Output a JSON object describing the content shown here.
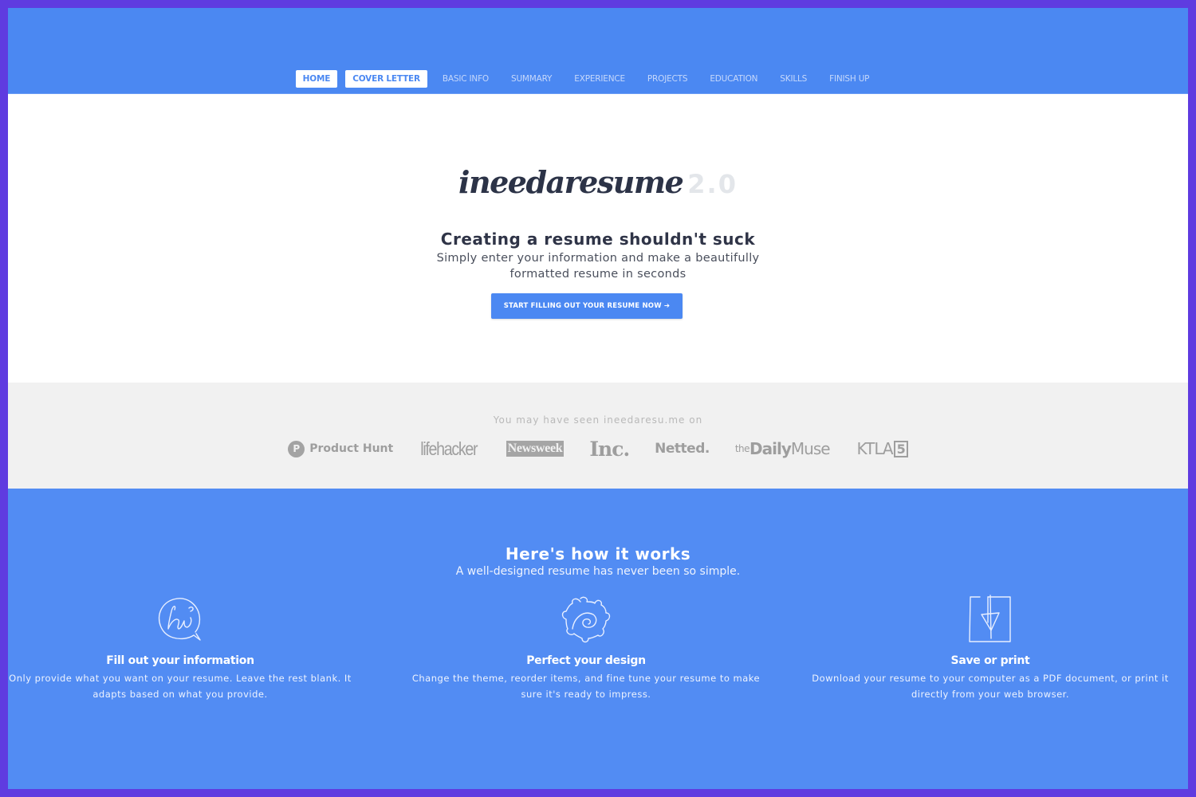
{
  "colors": {
    "frame": "#5f3be0",
    "primary": "#4b88f2",
    "how_bg": "#528cf3",
    "press_bg": "#f1f1f1",
    "heading": "#2f3447"
  },
  "nav": {
    "items": [
      {
        "label": "HOME",
        "active": true
      },
      {
        "label": "COVER LETTER",
        "active": true
      },
      {
        "label": "BASIC INFO",
        "active": false
      },
      {
        "label": "SUMMARY",
        "active": false
      },
      {
        "label": "EXPERIENCE",
        "active": false
      },
      {
        "label": "PROJECTS",
        "active": false
      },
      {
        "label": "EDUCATION",
        "active": false
      },
      {
        "label": "SKILLS",
        "active": false
      },
      {
        "label": "FINISH UP",
        "active": false
      }
    ]
  },
  "hero": {
    "logo_text": "ineedaresume",
    "logo_version": "2.0",
    "title": "Creating a resume shouldn't suck",
    "subtitle": "Simply enter your information and make a beautifully formatted resume in seconds",
    "cta_label": "START FILLING OUT YOUR RESUME NOW ➔"
  },
  "press": {
    "label": "You may have seen ineedaresu.me on",
    "logos": {
      "product_hunt_badge": "P",
      "product_hunt": "Product Hunt",
      "lifehacker": "lifehacker",
      "newsweek": "Newsweek",
      "inc": "Inc.",
      "netted": "Netted.",
      "daily_muse_the": "the",
      "daily_muse_daily": "Daily",
      "daily_muse_muse": "Muse",
      "ktla": "KTLA",
      "ktla_channel": "5"
    }
  },
  "how": {
    "title": "Here's how it works",
    "subtitle": "A well-designed resume has never been so simple.",
    "steps": [
      {
        "icon": "hi-speech-bubble-icon",
        "title": "Fill out your information",
        "description": "Only provide what you want on your resume. Leave the rest blank. It adapts based on what you provide."
      },
      {
        "icon": "gear-swirl-icon",
        "title": "Perfect your design",
        "description": "Change the theme, reorder items, and fine tune your resume to make sure it's ready to impress."
      },
      {
        "icon": "download-document-icon",
        "title": "Save or print",
        "description": "Download your resume to your computer as a PDF document, or print it directly from your web browser."
      }
    ]
  }
}
